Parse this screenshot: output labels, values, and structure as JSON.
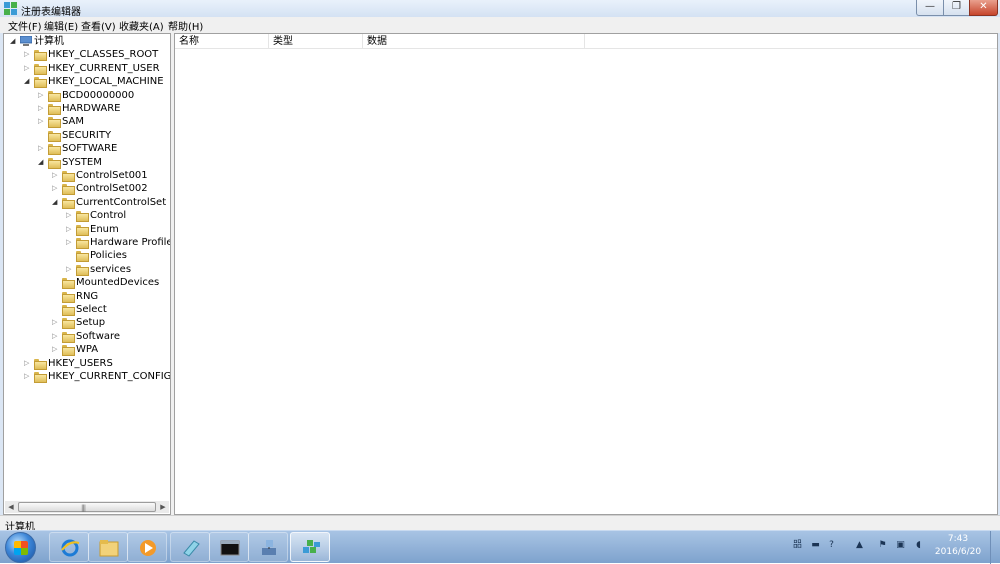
{
  "window": {
    "title": "注册表编辑器",
    "buttons": {
      "minimize": "—",
      "maximize": "❐",
      "close": "✕"
    }
  },
  "menu": [
    "文件(F)",
    "编辑(E)",
    "查看(V)",
    "收藏夹(A)",
    "帮助(H)"
  ],
  "tree": [
    {
      "label": "计算机",
      "icon": "computer-icon",
      "expanded": true
    },
    {
      "label": "HKEY_CLASSES_ROOT",
      "expanded": false
    },
    {
      "label": "HKEY_CURRENT_USER",
      "expanded": false
    },
    {
      "label": "HKEY_LOCAL_MACHINE",
      "expanded": true
    },
    {
      "label": "BCD00000000",
      "expanded": false
    },
    {
      "label": "HARDWARE",
      "expanded": false
    },
    {
      "label": "SAM",
      "expanded": false
    },
    {
      "label": "SECURITY",
      "expanded": false
    },
    {
      "label": "SOFTWARE",
      "expanded": false
    },
    {
      "label": "SYSTEM",
      "expanded": true
    },
    {
      "label": "ControlSet001",
      "expanded": false
    },
    {
      "label": "ControlSet002",
      "expanded": false
    },
    {
      "label": "CurrentControlSet",
      "expanded": true
    },
    {
      "label": "Control",
      "expanded": false
    },
    {
      "label": "Enum",
      "expanded": false
    },
    {
      "label": "Hardware Profiles",
      "expanded": false
    },
    {
      "label": "Policies",
      "expanded": false
    },
    {
      "label": "services",
      "expanded": false
    },
    {
      "label": "MountedDevices",
      "expanded": false
    },
    {
      "label": "RNG",
      "expanded": false
    },
    {
      "label": "Select",
      "expanded": false
    },
    {
      "label": "Setup",
      "expanded": false
    },
    {
      "label": "Software",
      "expanded": false
    },
    {
      "label": "WPA",
      "expanded": false
    },
    {
      "label": "HKEY_USERS",
      "expanded": false
    },
    {
      "label": "HKEY_CURRENT_CONFIG",
      "expanded": false
    }
  ],
  "list": {
    "columns": [
      "名称",
      "类型",
      "数据"
    ]
  },
  "status": "计算机",
  "taskbar": {
    "apps": [
      "internet-explorer-icon",
      "file-explorer-icon",
      "media-player-icon",
      "notepad-icon",
      "command-prompt-icon",
      "network-icon",
      "registry-editor-icon"
    ],
    "active_app": "registry-editor-icon",
    "tray": [
      "ime-icon",
      "keyboard-icon",
      "help-icon",
      "show-hidden-icons-icon",
      "flag-icon",
      "network-status-icon",
      "volume-icon"
    ],
    "clock_time": "7:43",
    "clock_date": "2016/6/20"
  },
  "colors": {
    "titlebar": "#dbe6f4",
    "taskbar": "#8fb0d8",
    "close_button": "#c6452b",
    "folder": "#f1d47b"
  }
}
